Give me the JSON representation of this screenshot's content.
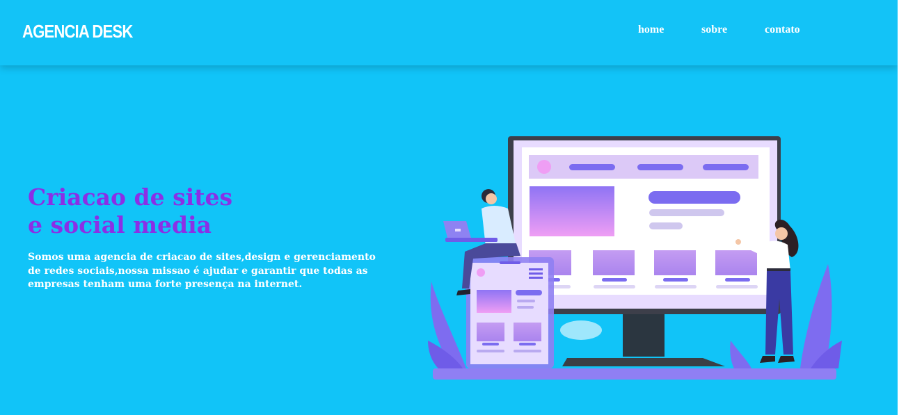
{
  "header": {
    "logo": "AGENCIA DESK",
    "nav": [
      {
        "label": "home"
      },
      {
        "label": "sobre"
      },
      {
        "label": "contato"
      }
    ]
  },
  "hero": {
    "title_line1": "Criacao de sites",
    "title_line2": "e social media",
    "text": "Somos uma agencia de criacao de sites,design e gerenciamento de redes sociais,nossa missao é ajudar e garantir que todas as empresas tenham uma forte presença na internet."
  },
  "colors": {
    "background": "#11c4f8",
    "title": "#8b2fe6",
    "text": "#ffffff",
    "illustration_accent": "#7b6cf0"
  },
  "illustration": {
    "icon": "website-design-illustration"
  }
}
